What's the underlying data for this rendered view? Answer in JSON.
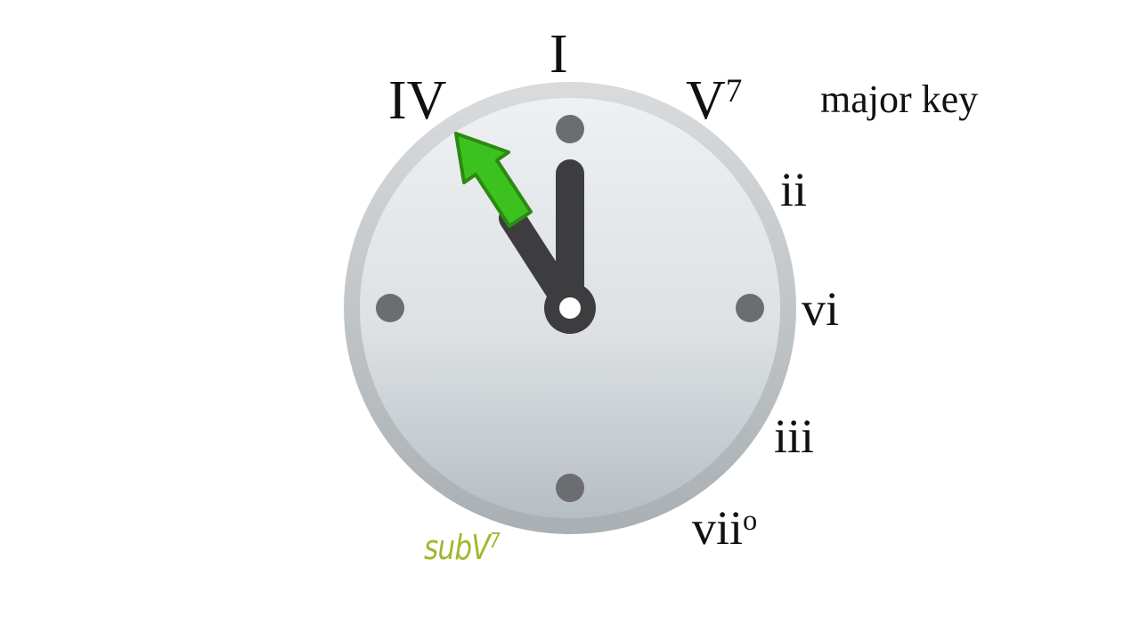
{
  "key_label": "major key",
  "chords": {
    "I": "I",
    "IV": "IV",
    "V_base": "V",
    "V_sup": "7",
    "ii": "ii",
    "vi": "vi",
    "iii": "iii",
    "vii_base": "vii",
    "vii_sup": "o"
  },
  "sub_label": {
    "base": "subV",
    "sup": "7"
  },
  "colors": {
    "arrow": "#3cc21f",
    "arrow_outline": "#2a8a14",
    "hands": "#3d3d3f",
    "sub_label": "#a4b62c"
  },
  "icons": [
    "clock-icon",
    "arrow-icon"
  ]
}
